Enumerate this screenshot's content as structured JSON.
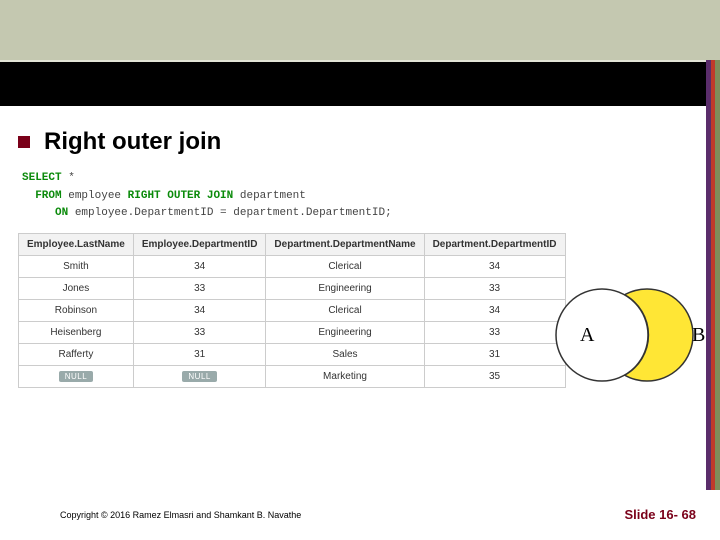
{
  "title": "Right outer join",
  "sql": {
    "select_kw": "SELECT",
    "select_cols": "*",
    "from_kw": "FROM",
    "from_tbl": "employee",
    "join_kw": "RIGHT OUTER JOIN",
    "join_tbl": "department",
    "on_kw": "ON",
    "on_expr": "employee.DepartmentID = department.DepartmentID;"
  },
  "table": {
    "headers": [
      "Employee.LastName",
      "Employee.DepartmentID",
      "Department.DepartmentName",
      "Department.DepartmentID"
    ],
    "rows": [
      {
        "cells": [
          "Smith",
          "34",
          "Clerical",
          "34"
        ],
        "nulls": [
          false,
          false,
          false,
          false
        ]
      },
      {
        "cells": [
          "Jones",
          "33",
          "Engineering",
          "33"
        ],
        "nulls": [
          false,
          false,
          false,
          false
        ]
      },
      {
        "cells": [
          "Robinson",
          "34",
          "Clerical",
          "34"
        ],
        "nulls": [
          false,
          false,
          false,
          false
        ]
      },
      {
        "cells": [
          "Heisenberg",
          "33",
          "Engineering",
          "33"
        ],
        "nulls": [
          false,
          false,
          false,
          false
        ]
      },
      {
        "cells": [
          "Rafferty",
          "31",
          "Sales",
          "31"
        ],
        "nulls": [
          false,
          false,
          false,
          false
        ]
      },
      {
        "cells": [
          "NULL",
          "NULL",
          "Marketing",
          "35"
        ],
        "nulls": [
          true,
          true,
          false,
          false
        ]
      }
    ]
  },
  "venn": {
    "labelA": "A",
    "labelB": "B"
  },
  "copyright": "Copyright © 2016 Ramez Elmasri and Shamkant B. Navathe",
  "slide": "Slide 16- 68"
}
